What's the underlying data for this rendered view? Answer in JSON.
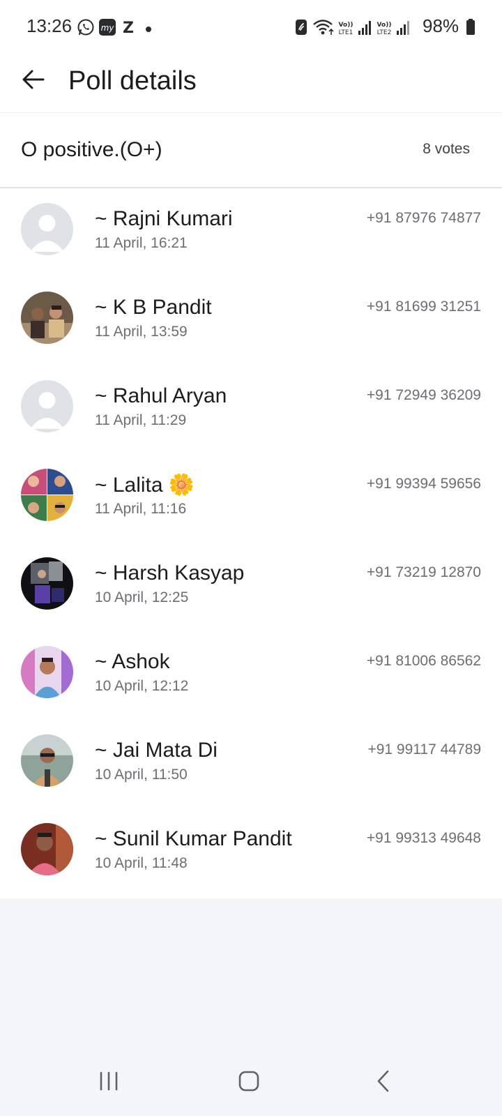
{
  "status_bar": {
    "time": "13:26",
    "icons": [
      "whatsapp-icon",
      "myjio-icon",
      "z-icon",
      "dot-icon",
      "nfc-icon",
      "wifi-icon",
      "volte-lte1-icon",
      "signal-icon",
      "volte-lte2-icon",
      "signal-icon",
      "battery-icon"
    ],
    "app_icon_labels": {
      "myjio": "my",
      "z": "Z"
    },
    "volte": {
      "top": "Vo))",
      "lte1": "LTE1",
      "lte2": "LTE2"
    },
    "battery": "98%"
  },
  "header": {
    "back_icon": "arrow-left-icon",
    "title": "Poll details"
  },
  "option": {
    "title": "O positive.(O+)",
    "votes": "8 votes"
  },
  "voters": [
    {
      "name": "~ Rajni Kumari",
      "time": "11 April, 16:21",
      "phone": "+91 87976 74877",
      "avatar": "default"
    },
    {
      "name": "~ K B Pandit",
      "time": "11 April, 13:59",
      "phone": "+91 81699 31251",
      "avatar": "photo"
    },
    {
      "name": "~ Rahul Aryan",
      "time": "11 April, 11:29",
      "phone": "+91 72949 36209",
      "avatar": "default"
    },
    {
      "name": "~ Lalita 🌼",
      "time": "11 April, 11:16",
      "phone": "+91 99394 59656",
      "avatar": "photo"
    },
    {
      "name": "~ Harsh Kasyap",
      "time": "10 April, 12:25",
      "phone": "+91 73219 12870",
      "avatar": "photo"
    },
    {
      "name": "~ Ashok",
      "time": "10 April, 12:12",
      "phone": "+91 81006 86562",
      "avatar": "photo"
    },
    {
      "name": "~ Jai Mata Di",
      "time": "10 April, 11:50",
      "phone": "+91 99117 44789",
      "avatar": "photo"
    },
    {
      "name": "~ Sunil Kumar Pandit",
      "time": "10 April, 11:48",
      "phone": "+91 99313 49648",
      "avatar": "photo"
    }
  ],
  "nav": {
    "recents_icon": "recents-icon",
    "home_icon": "home-icon",
    "back_icon": "back-chevron-icon"
  },
  "colors": {
    "background": "#f4f5f7",
    "surface": "#ffffff",
    "text_primary": "#1b1c1e",
    "text_secondary": "#6b6e72",
    "default_avatar": "#dfe2e6"
  }
}
